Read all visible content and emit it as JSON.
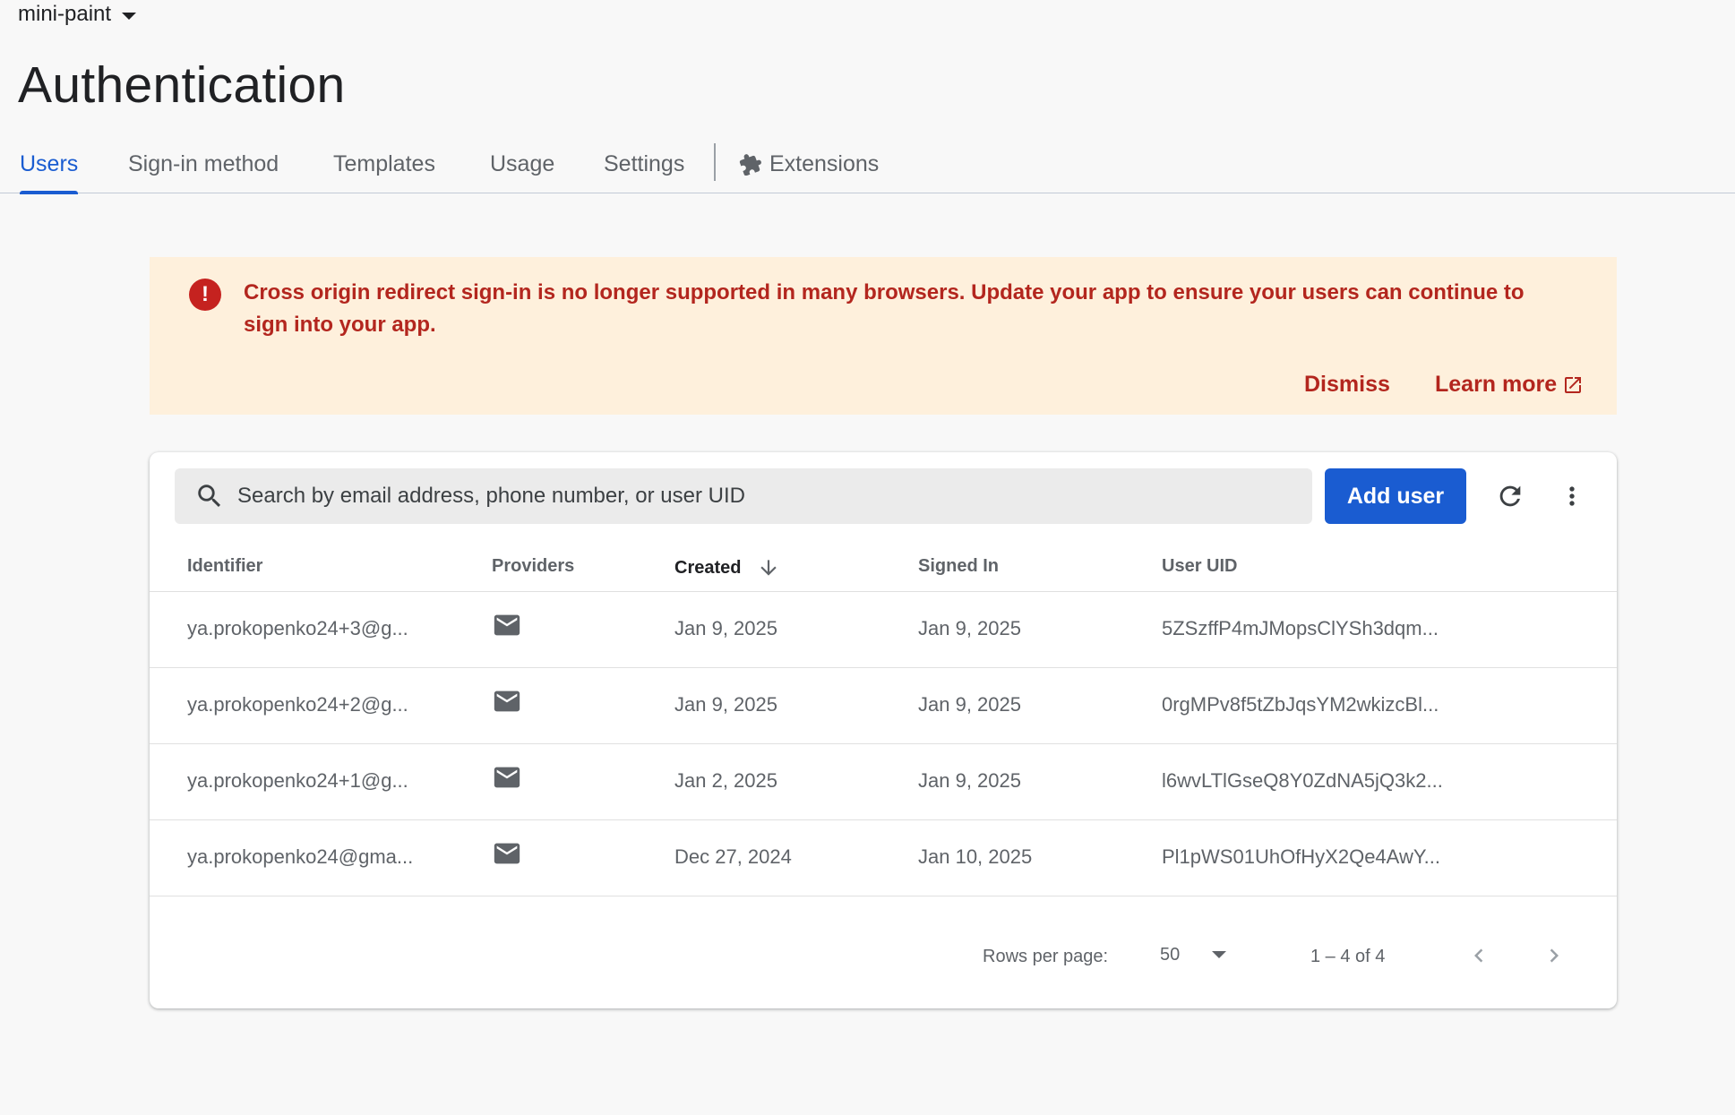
{
  "project": {
    "name": "mini-paint"
  },
  "page": {
    "title": "Authentication"
  },
  "tabs": [
    {
      "label": "Users",
      "active": true
    },
    {
      "label": "Sign-in method"
    },
    {
      "label": "Templates"
    },
    {
      "label": "Usage"
    },
    {
      "label": "Settings"
    },
    {
      "label": "Extensions",
      "icon": "puzzle-piece-icon"
    }
  ],
  "banner": {
    "icon": "error-icon",
    "message": "Cross origin redirect sign-in is no longer supported in many browsers. Update your app to ensure your users can continue to sign into your app.",
    "dismiss_label": "Dismiss",
    "learn_more_label": "Learn more",
    "learn_more_icon": "open-in-new-icon"
  },
  "toolbar": {
    "search_placeholder": "Search by email address, phone number, or user UID",
    "search_value": "",
    "add_user_label": "Add user",
    "refresh_icon": "refresh-icon",
    "more_icon": "more-vert-icon"
  },
  "table": {
    "columns": {
      "identifier": "Identifier",
      "providers": "Providers",
      "created": "Created",
      "signed_in": "Signed In",
      "user_uid": "User UID"
    },
    "sort": {
      "column": "Created",
      "direction": "descending"
    },
    "rows": [
      {
        "identifier": "ya.prokopenko24+3@g...",
        "provider": "email-icon",
        "created": "Jan 9, 2025",
        "signed_in": "Jan 9, 2025",
        "uid": "5ZSzffP4mJMopsClYSh3dqm..."
      },
      {
        "identifier": "ya.prokopenko24+2@g...",
        "provider": "email-icon",
        "created": "Jan 9, 2025",
        "signed_in": "Jan 9, 2025",
        "uid": "0rgMPv8f5tZbJqsYM2wkizcBl..."
      },
      {
        "identifier": "ya.prokopenko24+1@g...",
        "provider": "email-icon",
        "created": "Jan 2, 2025",
        "signed_in": "Jan 9, 2025",
        "uid": "l6wvLTlGseQ8Y0ZdNA5jQ3k2..."
      },
      {
        "identifier": "ya.prokopenko24@gma...",
        "provider": "email-icon",
        "created": "Dec 27, 2024",
        "signed_in": "Jan 10, 2025",
        "uid": "Pl1pWS01UhOfHyX2Qe4AwY..."
      }
    ]
  },
  "pagination": {
    "rows_per_page_label": "Rows per page:",
    "rows_per_page": "50",
    "range": "1 – 4 of 4"
  },
  "colors": {
    "accent": "#1a5cd1",
    "banner_bg": "#fef0dc",
    "banner_text": "#b3261e"
  }
}
